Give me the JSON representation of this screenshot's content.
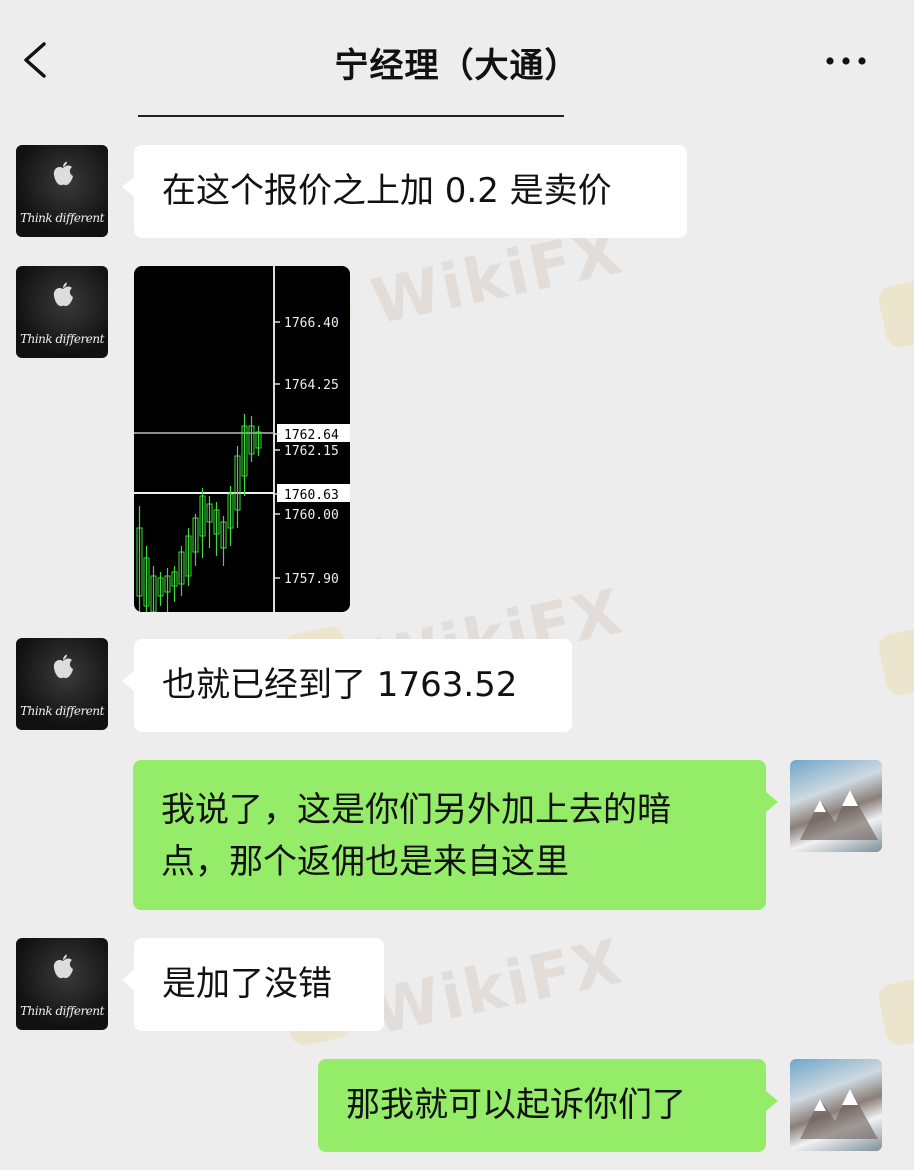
{
  "header": {
    "title": "宁经理（大通）"
  },
  "messages": [
    {
      "text": "在这个报价之上加 0.2 是卖价"
    },
    {
      "chart": true
    },
    {
      "text": "也就已经到了 1763.52"
    },
    {
      "text_line1": "我说了，这是你们另外加上去的暗",
      "text_line2": "点，那个返佣也是来自这里"
    },
    {
      "text": "是加了没错"
    },
    {
      "text": "那我就可以起诉你们了"
    }
  ],
  "avatar": {
    "caption": "Think different"
  },
  "chart_data": {
    "type": "candlestick",
    "ticks": [
      "1766.40",
      "1764.25",
      "1762.64",
      "1762.15",
      "1760.63",
      "1760.00",
      "1757.90"
    ],
    "price_lines": [
      "1762.64",
      "1760.63"
    ]
  },
  "watermark": {
    "text": "WikiFX"
  },
  "colors": {
    "green_bubble": "#95ec69",
    "background": "#ededed"
  }
}
